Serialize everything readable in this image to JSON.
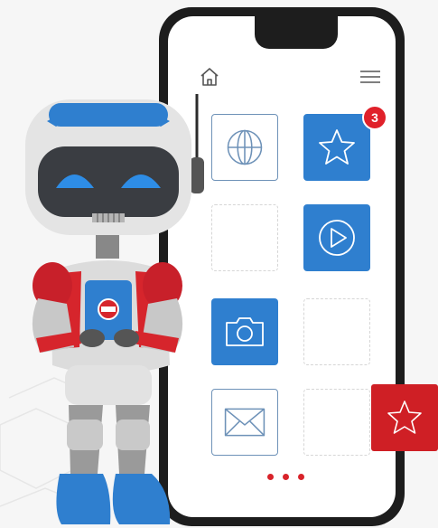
{
  "phone": {
    "notification_count": "3",
    "tiles": [
      {
        "name": "browser-app-tile",
        "icon": "globe-icon",
        "style": "outline"
      },
      {
        "name": "favorites-app-tile",
        "icon": "star-icon",
        "style": "filled"
      },
      {
        "name": "empty-slot",
        "style": "empty"
      },
      {
        "name": "video-app-tile",
        "icon": "play-icon",
        "style": "filled"
      },
      {
        "name": "camera-app-tile",
        "icon": "camera-icon",
        "style": "filled"
      },
      {
        "name": "empty-slot",
        "style": "empty"
      },
      {
        "name": "mail-app-tile",
        "icon": "mail-icon",
        "style": "outline"
      },
      {
        "name": "empty-slot",
        "style": "empty"
      }
    ],
    "page_dots": 3
  },
  "robot_badge": "",
  "colors": {
    "accent_blue": "#2f7fcf",
    "outline_blue": "#6e92b8",
    "accent_red": "#cf1f25",
    "phone_frame": "#1d1d1d",
    "background": "#f6f6f6"
  }
}
